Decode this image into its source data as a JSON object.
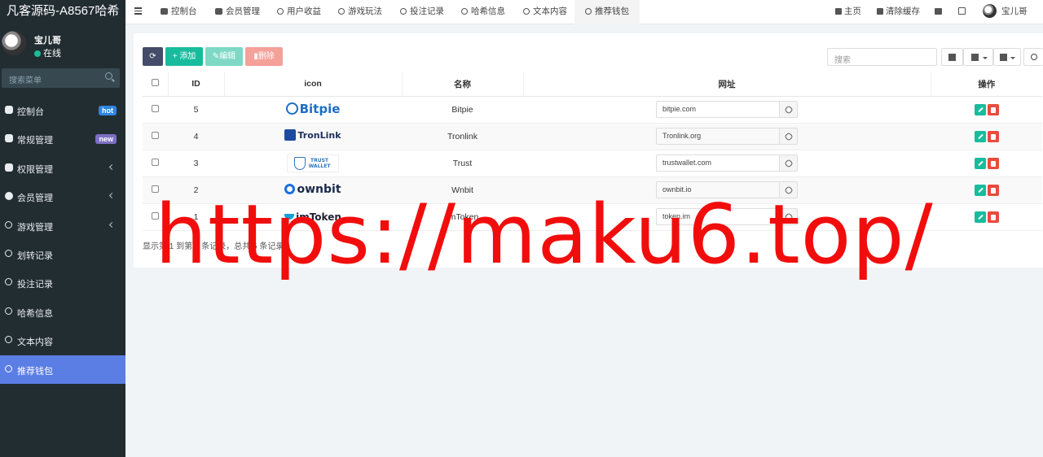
{
  "app": {
    "title": "凡客源码-A8567哈希"
  },
  "user": {
    "name": "宝儿哥",
    "status": "在线"
  },
  "sidebar": {
    "search_placeholder": "搜索菜单",
    "items": [
      {
        "label": "控制台",
        "badge": "hot"
      },
      {
        "label": "常规管理",
        "badge": "new"
      },
      {
        "label": "权限管理"
      },
      {
        "label": "会员管理"
      },
      {
        "label": "游戏管理"
      },
      {
        "label": "划转记录"
      },
      {
        "label": "投注记录"
      },
      {
        "label": "哈希信息"
      },
      {
        "label": "文本内容"
      },
      {
        "label": "推荐钱包"
      }
    ]
  },
  "navbar": {
    "tabs": [
      "控制台",
      "会员管理",
      "用户收益",
      "游戏玩法",
      "投注记录",
      "哈希信息",
      "文本内容",
      "推荐钱包"
    ],
    "home": "主页",
    "clear_cache": "清除缓存",
    "user_name": "宝儿哥"
  },
  "toolbar": {
    "add": "添加",
    "edit": "编辑",
    "delete": "删除",
    "search_placeholder": "搜索"
  },
  "table": {
    "headers": {
      "id": "ID",
      "icon": "icon",
      "name": "名称",
      "url": "网址",
      "ops": "操作"
    },
    "rows": [
      {
        "id": "5",
        "logo": "Bitpie",
        "name": "Bitpie",
        "url": "bitpie.com"
      },
      {
        "id": "4",
        "logo": "TronLink",
        "name": "Tronlink",
        "url": "Tronlink.org"
      },
      {
        "id": "3",
        "logo": "TRUST WALLET",
        "name": "Trust",
        "url": "trustwallet.com"
      },
      {
        "id": "2",
        "logo": "ownbit",
        "name": "Wnbit",
        "url": "ownbit.io"
      },
      {
        "id": "1",
        "logo": "imToken",
        "name": "ImToken",
        "url": "token.im"
      }
    ]
  },
  "footer": {
    "summary": "显示第 1 到第 5 条记录，总共 5 条记录"
  },
  "watermark": "https://maku6.top/",
  "colors": {
    "sidebar_bg": "#222d32",
    "active_menu": "#5b7ee5",
    "primary": "#18bc9c",
    "danger": "#e74c3c",
    "watermark": "#f20d0d"
  }
}
